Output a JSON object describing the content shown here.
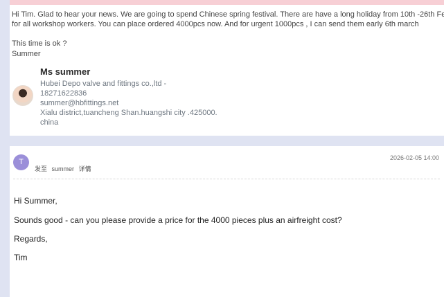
{
  "first_email": {
    "lines": [
      "Hi Tim. Glad to hear your news. We are going to spend Chinese spring festival. There are have a long holiday from 10th -26th Feb",
      "for all workshop workers.  You can place ordered 4000pcs now. And for urgent 1000pcs , I can send them early 6th march",
      "",
      "This time is ok ?",
      "Summer"
    ],
    "signature": {
      "name": "Ms summer",
      "company": "Hubei Depo valve and fittings co.,ltd  -",
      "phone": "18271622836",
      "email": "summer@hbfittings.net",
      "address": "Xialu district,tuancheng Shan.huangshi city .425000.",
      "country": "china"
    }
  },
  "second_email": {
    "avatar_letter": "T",
    "date": "2026-02-05 14:00",
    "sent_to_label": "发至",
    "recipient": "summer",
    "details_label": "详情",
    "body": [
      "Hi Summer,",
      "Sounds good - can you please provide a price for the 4000 pieces plus an airfreight cost?",
      "Regards,",
      "Tim"
    ]
  },
  "colors": {
    "background": "#dfe3f2",
    "accent_bar": "#f7cfd5",
    "avatar_purple": "#9b8fd9"
  }
}
